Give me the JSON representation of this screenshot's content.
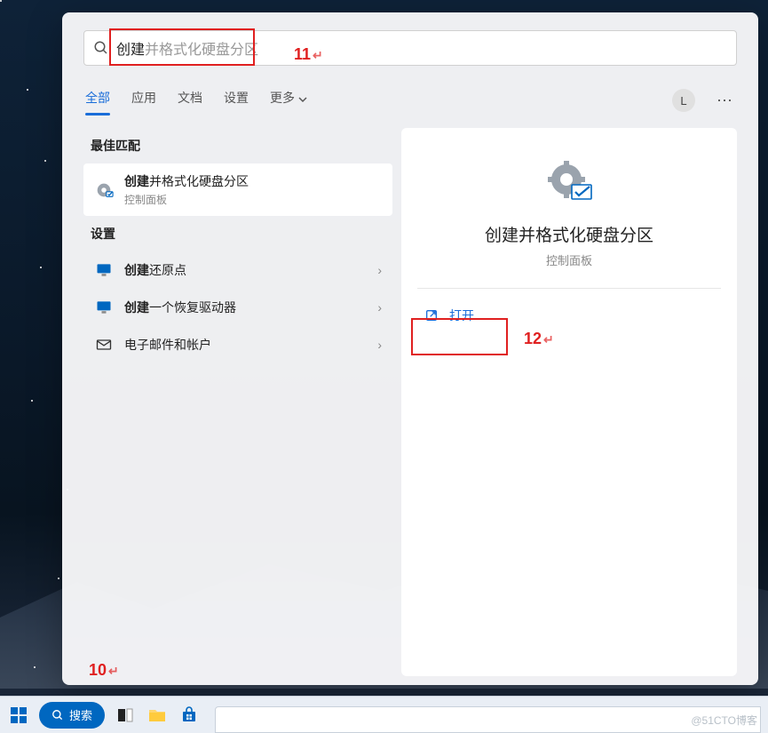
{
  "search": {
    "typed": "创建",
    "ghost": "并格式化硬盘分区"
  },
  "tabs": {
    "all": "全部",
    "apps": "应用",
    "docs": "文档",
    "settings": "设置",
    "more": "更多"
  },
  "user_initial": "L",
  "sections": {
    "best_match": "最佳匹配",
    "settings": "设置"
  },
  "results": {
    "best": {
      "bold": "创建",
      "rest": "并格式化硬盘分区",
      "sub": "控制面板"
    },
    "r1": {
      "bold": "创建",
      "rest": "还原点"
    },
    "r2": {
      "bold": "创建",
      "rest": "一个恢复驱动器"
    },
    "r3": {
      "title": "电子邮件和帐户"
    }
  },
  "detail": {
    "title": "创建并格式化硬盘分区",
    "sub": "控制面板",
    "open": "打开"
  },
  "annotations": {
    "a10": "10",
    "a11": "11",
    "a12": "12"
  },
  "taskbar": {
    "search_label": "搜索"
  },
  "watermark": "@51CTO博客"
}
